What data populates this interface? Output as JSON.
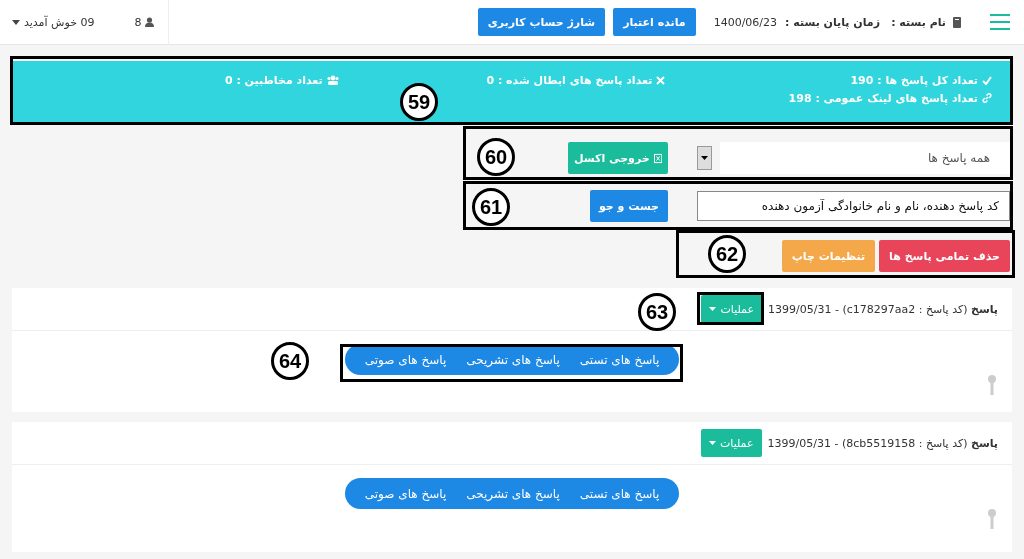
{
  "header": {
    "package_label": "نام بسته :",
    "end_label": "زمان پایان بسته :",
    "end_date": "1400/06/23",
    "buttons": [
      "مانده اعتبار",
      "شارژ حساب کاربری"
    ],
    "user_count": "8",
    "welcome": "09 خوش آمدید"
  },
  "stats": [
    {
      "kind": "check",
      "text": "تعداد کل پاسخ ها : 190"
    },
    {
      "kind": "cross",
      "text": "تعداد پاسخ های ابطال شده : 0"
    },
    {
      "kind": "users",
      "text": "تعداد مخاطبین : 0"
    },
    {
      "kind": "link",
      "text": "تعداد پاسخ های لینک عمومی : 198"
    }
  ],
  "filter": {
    "value": "همه پاسخ ها",
    "excel_button": "خروجی اکسل"
  },
  "search": {
    "placeholder": "کد پاسخ دهنده، نام و نام خانوادگی آزمون دهنده",
    "button": "جست و جو"
  },
  "actions": [
    {
      "kind": "danger",
      "label": "حذف تمامی پاسخ ها"
    },
    {
      "kind": "warning",
      "label": "تنظیمات چاپ"
    }
  ],
  "responses": [
    {
      "title": "**پاسخ** (کد پاسخ : c178297aa2) - 1399/05/31",
      "ops_button": "عملیات",
      "tabs": [
        "پاسخ های تستی",
        "پاسخ های تشریحی",
        "پاسخ های صوتی"
      ]
    },
    {
      "title": "**پاسخ** (کد پاسخ : 8cb5519158) - 1399/05/31",
      "ops_button": "عملیات",
      "tabs": [
        "پاسخ های تستی",
        "پاسخ های تشریحی",
        "پاسخ های صوتی"
      ]
    }
  ],
  "callouts": [
    {
      "number": "59"
    },
    {
      "number": "60"
    },
    {
      "number": "61"
    },
    {
      "number": "62"
    },
    {
      "number": "63"
    },
    {
      "number": "64"
    }
  ]
}
